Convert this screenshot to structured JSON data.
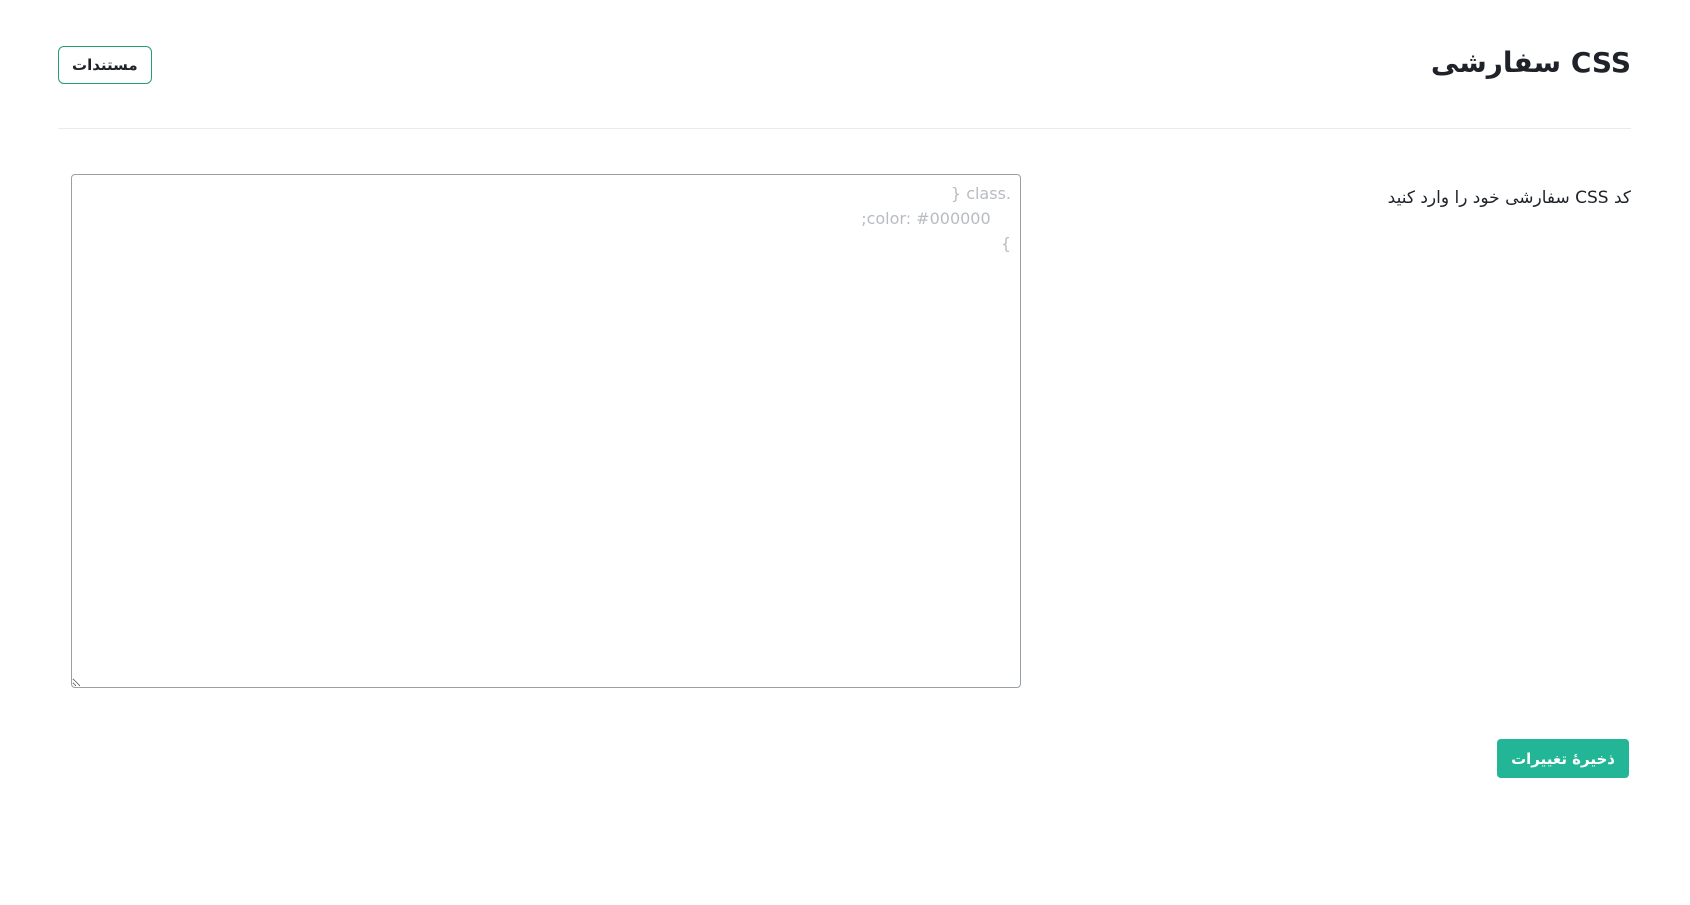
{
  "header": {
    "title": "CSS سفارشی",
    "docs_button_label": "مستندات"
  },
  "form": {
    "field_label": "کد CSS سفارشی خود را وارد کنید",
    "textarea_value": "",
    "textarea_placeholder": ".class {\n    color: #000000;\n}",
    "save_button_label": "ذخیرهٔ تغییرات"
  },
  "colors": {
    "accent_green": "#22b596",
    "outline_green": "#22a06b",
    "placeholder_gray": "#b8bcc2"
  }
}
